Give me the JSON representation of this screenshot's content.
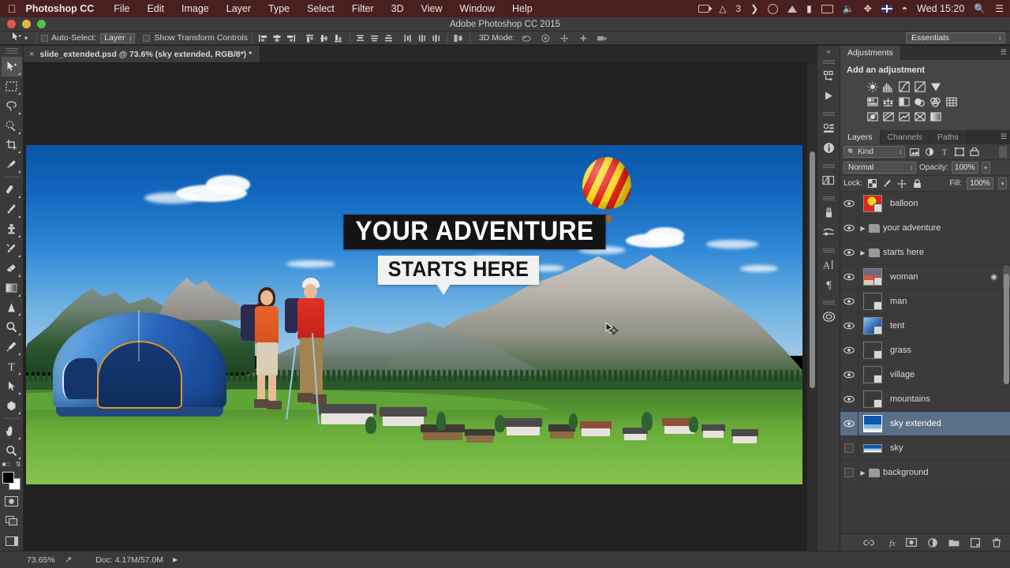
{
  "os_menu": {
    "apple_icon": "apple-icon",
    "app_name": "Photoshop CC",
    "items": [
      "File",
      "Edit",
      "Image",
      "Layer",
      "Type",
      "Select",
      "Filter",
      "3D",
      "View",
      "Window",
      "Help"
    ],
    "status_icons": [
      "screen-record-icon",
      "adobe-icon",
      "chevron-icon",
      "creative-cloud-icon",
      "dropbox-icon",
      "card-icon",
      "display-icon",
      "volume-icon",
      "bluetooth-icon",
      "keyboard-flag-icon",
      "wifi-icon",
      "spotlight-search-icon",
      "notification-center-icon"
    ],
    "badge_count": "3",
    "clock": "Wed 15:20"
  },
  "window": {
    "title": "Adobe Photoshop CC 2015"
  },
  "options_bar": {
    "tool_icon": "move-tool-icon",
    "auto_select_label": "Auto-Select:",
    "auto_select_checked": false,
    "auto_select_value": "Layer",
    "show_transform_label": "Show Transform Controls",
    "show_transform_checked": false,
    "align_icons": [
      "align-left-edges-icon",
      "align-horizontal-centers-icon",
      "align-right-edges-icon",
      "align-top-edges-icon",
      "align-vertical-centers-icon",
      "align-bottom-edges-icon"
    ],
    "distribute_icons": [
      "distribute-top-edges-icon",
      "distribute-vertical-centers-icon",
      "distribute-bottom-edges-icon",
      "distribute-left-edges-icon",
      "distribute-horizontal-centers-icon",
      "distribute-right-edges-icon"
    ],
    "auto_align_icon": "auto-align-layers-icon",
    "mode_3d_label": "3D Mode:",
    "mode_3d_icons": [
      "rotate-3d-icon",
      "roll-3d-icon",
      "drag-3d-icon",
      "slide-3d-icon",
      "scale-3d-icon"
    ],
    "workspace": "Essentials"
  },
  "document_tab": {
    "close_icon": "close-icon",
    "title": "slide_extended.psd @ 73.6% (sky extended, RGB/8*) *"
  },
  "toolbar": {
    "tools": [
      {
        "name": "move-tool",
        "active": true,
        "has_submenu": true
      },
      {
        "name": "rectangular-marquee-tool",
        "active": false,
        "has_submenu": true
      },
      {
        "name": "lasso-tool",
        "active": false,
        "has_submenu": true
      },
      {
        "name": "quick-selection-tool",
        "active": false,
        "has_submenu": true
      },
      {
        "name": "crop-tool",
        "active": false,
        "has_submenu": true
      },
      {
        "name": "eyedropper-tool",
        "active": false,
        "has_submenu": true
      },
      {
        "name": "spot-healing-brush-tool",
        "active": false,
        "has_submenu": true
      },
      {
        "name": "brush-tool",
        "active": false,
        "has_submenu": true
      },
      {
        "name": "clone-stamp-tool",
        "active": false,
        "has_submenu": true
      },
      {
        "name": "history-brush-tool",
        "active": false,
        "has_submenu": true
      },
      {
        "name": "eraser-tool",
        "active": false,
        "has_submenu": true
      },
      {
        "name": "gradient-tool",
        "active": false,
        "has_submenu": true
      },
      {
        "name": "blur-tool",
        "active": false,
        "has_submenu": true
      },
      {
        "name": "dodge-tool",
        "active": false,
        "has_submenu": true
      },
      {
        "name": "pen-tool",
        "active": false,
        "has_submenu": true
      },
      {
        "name": "type-tool",
        "active": false,
        "has_submenu": true
      },
      {
        "name": "path-selection-tool",
        "active": false,
        "has_submenu": true
      },
      {
        "name": "shape-tool",
        "active": false,
        "has_submenu": true
      },
      {
        "name": "hand-tool",
        "active": false,
        "has_submenu": true
      },
      {
        "name": "zoom-tool",
        "active": false,
        "has_submenu": true
      }
    ],
    "foreground_color": "#000000",
    "background_color": "#ffffff",
    "quick_mask_icon": "quick-mask-icon",
    "screen_mode_icon": "screen-mode-icon",
    "extras_icon": "toolbar-extras-icon"
  },
  "canvas": {
    "artwork_title_line1": "YOUR ADVENTURE",
    "artwork_title_line2": "STARTS HERE",
    "cursor_icon": "move-tool-cursor"
  },
  "right_rail": {
    "collapse_icon": "collapse-panels-icon",
    "groups": [
      [
        "history-panel-icon",
        "actions-panel-icon"
      ],
      [
        "properties-panel-icon",
        "info-panel-icon"
      ],
      [
        "color-swatches-panel-icon"
      ],
      [
        "brush-panel-icon",
        "brush-settings-panel-icon"
      ],
      [
        "character-panel-icon",
        "paragraph-panel-icon"
      ],
      [
        "cc-libraries-panel-icon"
      ]
    ]
  },
  "adjustments_panel": {
    "tab_label": "Adjustments",
    "menu_icon": "panel-menu-icon",
    "heading": "Add an adjustment",
    "rows": [
      [
        "brightness-contrast-icon",
        "levels-icon",
        "curves-icon",
        "exposure-icon",
        "vibrance-icon"
      ],
      [
        "hue-saturation-icon",
        "color-balance-icon",
        "black-white-icon",
        "photo-filter-icon",
        "channel-mixer-icon",
        "color-lookup-icon"
      ],
      [
        "invert-icon",
        "posterize-icon",
        "threshold-icon",
        "selective-color-icon",
        "gradient-map-icon"
      ]
    ]
  },
  "layers_panel": {
    "tabs": [
      {
        "label": "Layers",
        "active": true
      },
      {
        "label": "Channels",
        "active": false
      },
      {
        "label": "Paths",
        "active": false
      }
    ],
    "menu_icon": "panel-menu-icon",
    "filter": {
      "search_icon": "search-icon",
      "kind_label": "Kind",
      "type_filters": [
        "filter-pixel-icon",
        "filter-adjustment-icon",
        "filter-type-icon",
        "filter-shape-icon",
        "filter-smart-object-icon"
      ],
      "toggle_icon": "filter-toggle-icon"
    },
    "blend_mode": "Normal",
    "opacity_label": "Opacity:",
    "opacity_value": "100%",
    "lock_label": "Lock:",
    "lock_icons": [
      "lock-transparent-pixels-icon",
      "lock-image-pixels-icon",
      "lock-position-icon",
      "lock-all-icon"
    ],
    "fill_label": "Fill:",
    "fill_value": "100%",
    "layers": [
      {
        "name": "balloon",
        "visible": true,
        "type": "image",
        "selected": false,
        "has_group": false,
        "thumb": "balloon-thumbnail"
      },
      {
        "name": "your adventure",
        "visible": true,
        "type": "group",
        "selected": false,
        "has_group": true,
        "thumb": "folder-icon"
      },
      {
        "name": "starts here",
        "visible": true,
        "type": "group",
        "selected": false,
        "has_group": true,
        "thumb": "folder-icon"
      },
      {
        "name": "woman",
        "visible": true,
        "type": "image",
        "selected": false,
        "has_group": false,
        "thumb": "woman-thumbnail",
        "has_effects": true
      },
      {
        "name": "man",
        "visible": true,
        "type": "image",
        "selected": false,
        "has_group": false,
        "thumb": "man-thumbnail"
      },
      {
        "name": "tent",
        "visible": true,
        "type": "image",
        "selected": false,
        "has_group": false,
        "thumb": "tent-thumbnail"
      },
      {
        "name": "grass",
        "visible": true,
        "type": "image",
        "selected": false,
        "has_group": false,
        "thumb": "grass-thumbnail"
      },
      {
        "name": "village",
        "visible": true,
        "type": "image",
        "selected": false,
        "has_group": false,
        "thumb": "village-thumbnail"
      },
      {
        "name": "mountains",
        "visible": true,
        "type": "image",
        "selected": false,
        "has_group": false,
        "thumb": "mountains-thumbnail"
      },
      {
        "name": "sky extended",
        "visible": true,
        "type": "image",
        "selected": true,
        "has_group": false,
        "thumb": "sky-extended-thumbnail"
      },
      {
        "name": "sky",
        "visible": false,
        "type": "image",
        "selected": false,
        "has_group": false,
        "thumb": "sky-thumbnail"
      },
      {
        "name": "background",
        "visible": false,
        "type": "group",
        "selected": false,
        "has_group": true,
        "thumb": "folder-icon"
      }
    ],
    "bottom_buttons": [
      "link-layers-icon",
      "layer-style-fx-icon",
      "add-layer-mask-icon",
      "new-adjustment-layer-icon",
      "new-group-icon",
      "new-layer-icon",
      "delete-layer-icon"
    ]
  },
  "status_bar": {
    "zoom_level": "73.65%",
    "share_icon": "share-icon",
    "doc_info": "Doc: 4.17M/57.0M",
    "expand_icon": "expand-arrow-icon"
  },
  "colors": {
    "menu_bar": "#4a1f1f",
    "panel_bg": "#3a3a3a",
    "canvas_bg": "#222222",
    "selection_blue": "#5a6f88",
    "text": "#dcdcdc"
  }
}
